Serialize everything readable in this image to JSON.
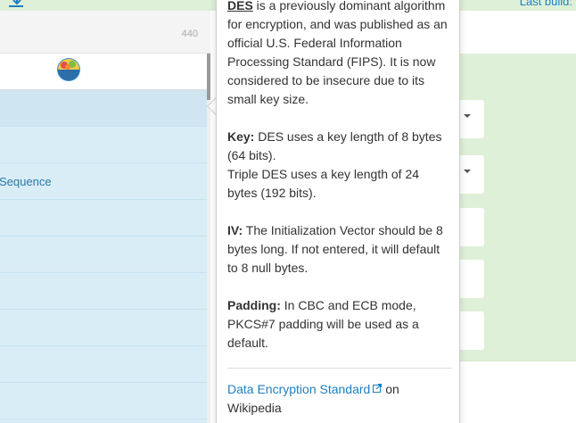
{
  "top_bar": {
    "download_icon": "download-icon",
    "last_build_label": "Last build:"
  },
  "search": {
    "count": "440"
  },
  "logo": {
    "icon": "cyberchef-logo"
  },
  "operations": {
    "items": [
      {
        "label": ""
      },
      {
        "label": ""
      },
      {
        "label": "Sequence"
      },
      {
        "label": ""
      },
      {
        "label": ""
      },
      {
        "label": ""
      },
      {
        "label": ""
      },
      {
        "label": ""
      },
      {
        "label": ""
      }
    ]
  },
  "popover": {
    "des_intro_title": "DES",
    "des_intro_text": " is a previously dominant algorithm for encryption, and was published as an official U.S. Federal Information Processing Standard (FIPS). It is now considered to be insecure due to its small key size.",
    "key_label": "Key:",
    "key_text_1": " DES uses a key length of 8 bytes (64 bits).",
    "key_text_2": "Triple DES uses a key length of 24 bytes (192 bits).",
    "iv_label": "IV:",
    "iv_text": " The Initialization Vector should be 8 bytes long. If not entered, it will default to 8 null bytes.",
    "padding_label": "Padding:",
    "padding_text": " In CBC and ECB mode, PKCS#7 padding will be used as a default.",
    "link_text": "Data Encryption Standard",
    "link_suffix": " on Wikipedia",
    "external_icon": "external-link-icon"
  },
  "colors": {
    "accent_link": "#1f7fbf",
    "operations_bg": "#d9edf7",
    "recipe_bg": "#dff0d8"
  }
}
